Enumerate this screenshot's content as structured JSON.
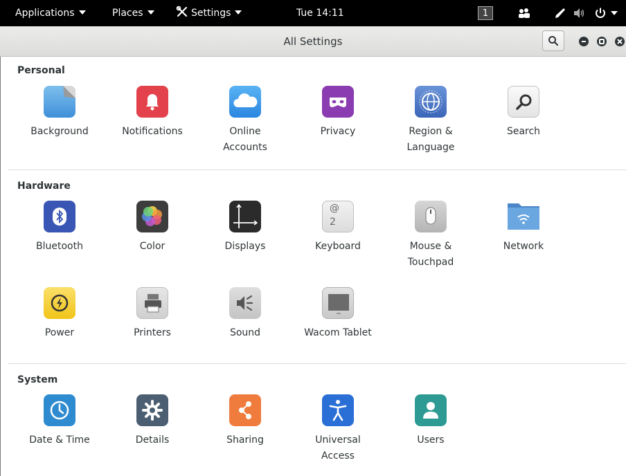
{
  "topbar": {
    "applications": "Applications",
    "places": "Places",
    "settings": "Settings",
    "clock": "Tue 14:11",
    "workspace": "1"
  },
  "window": {
    "title": "All Settings"
  },
  "sections": {
    "personal": {
      "title": "Personal",
      "items": [
        "Background",
        "Notifications",
        "Online\nAccounts",
        "Privacy",
        "Region &\nLanguage",
        "Search"
      ]
    },
    "hardware": {
      "title": "Hardware",
      "items": [
        "Bluetooth",
        "Color",
        "Displays",
        "Keyboard",
        "Mouse &\nTouchpad",
        "Network",
        "Power",
        "Printers",
        "Sound",
        "Wacom Tablet"
      ]
    },
    "system": {
      "title": "System",
      "items": [
        "Date & Time",
        "Details",
        "Sharing",
        "Universal\nAccess",
        "Users"
      ]
    }
  },
  "keyboard_icon_glyphs": [
    "@",
    "2"
  ]
}
